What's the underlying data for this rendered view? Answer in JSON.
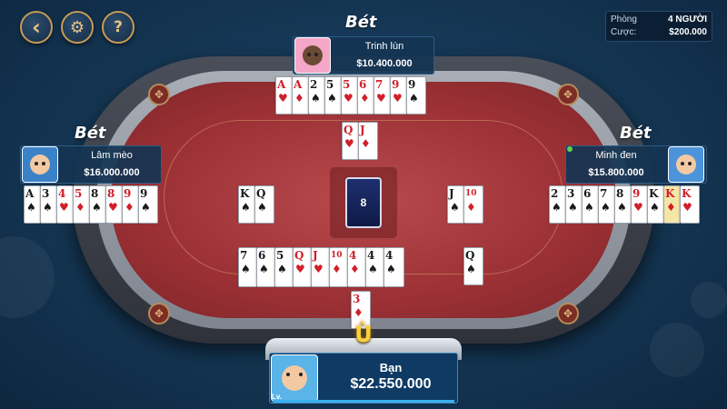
{
  "controls": {
    "back_icon": "‹",
    "settings_icon": "⚙",
    "help_icon": "?"
  },
  "room": {
    "room_label": "Phòng",
    "room_value": "4 NGƯỜI",
    "bet_label": "Cược:",
    "bet_value": "$200.000"
  },
  "center": {
    "deck_count": "8"
  },
  "players": {
    "top": {
      "status": "Bét",
      "name": "Trinh lùn",
      "money": "$10.400.000",
      "hand": [
        {
          "r": "A",
          "s": "♥",
          "c": "red"
        },
        {
          "r": "A",
          "s": "♦",
          "c": "red"
        },
        {
          "r": "2",
          "s": "♠",
          "c": "black"
        },
        {
          "r": "5",
          "s": "♠",
          "c": "black"
        },
        {
          "r": "5",
          "s": "♥",
          "c": "red"
        },
        {
          "r": "6",
          "s": "♦",
          "c": "red"
        },
        {
          "r": "7",
          "s": "♥",
          "c": "red"
        },
        {
          "r": "9",
          "s": "♥",
          "c": "red"
        },
        {
          "r": "9",
          "s": "♠",
          "c": "black"
        }
      ],
      "discards": [
        {
          "r": "Q",
          "s": "♥",
          "c": "red"
        },
        {
          "r": "J",
          "s": "♦",
          "c": "red"
        }
      ]
    },
    "left": {
      "status": "Bét",
      "name": "Lâm mèo",
      "money": "$16.000.000",
      "hand": [
        {
          "r": "A",
          "s": "♠",
          "c": "black"
        },
        {
          "r": "3",
          "s": "♠",
          "c": "black"
        },
        {
          "r": "4",
          "s": "♥",
          "c": "red"
        },
        {
          "r": "5",
          "s": "♦",
          "c": "red"
        },
        {
          "r": "8",
          "s": "♠",
          "c": "black"
        },
        {
          "r": "8",
          "s": "♥",
          "c": "red"
        },
        {
          "r": "9",
          "s": "♦",
          "c": "red"
        },
        {
          "r": "9",
          "s": "♠",
          "c": "black"
        }
      ],
      "discards": [
        {
          "r": "K",
          "s": "♠",
          "c": "black"
        },
        {
          "r": "Q",
          "s": "♠",
          "c": "black"
        }
      ]
    },
    "right": {
      "status": "Bét",
      "name": "Minh đen",
      "money": "$15.800.000",
      "hand": [
        {
          "r": "2",
          "s": "♠",
          "c": "black"
        },
        {
          "r": "3",
          "s": "♠",
          "c": "black"
        },
        {
          "r": "6",
          "s": "♠",
          "c": "black"
        },
        {
          "r": "7",
          "s": "♠",
          "c": "black"
        },
        {
          "r": "8",
          "s": "♠",
          "c": "black"
        },
        {
          "r": "9",
          "s": "♥",
          "c": "red"
        },
        {
          "r": "K",
          "s": "♠",
          "c": "black"
        },
        {
          "r": "K",
          "s": "♦",
          "c": "red",
          "hl": true
        },
        {
          "r": "K",
          "s": "♥",
          "c": "red"
        }
      ],
      "discards": [
        {
          "r": "J",
          "s": "♠",
          "c": "black"
        },
        {
          "r": "10",
          "s": "♦",
          "c": "red"
        }
      ]
    },
    "me": {
      "status_glyph": "Ù",
      "name": "Bạn",
      "money": "$22.550.000",
      "level_label": "Lv.",
      "hand": [
        {
          "r": "7",
          "s": "♠",
          "c": "black"
        },
        {
          "r": "6",
          "s": "♠",
          "c": "black"
        },
        {
          "r": "5",
          "s": "♠",
          "c": "black"
        },
        {
          "r": "Q",
          "s": "♥",
          "c": "red"
        },
        {
          "r": "J",
          "s": "♥",
          "c": "red"
        },
        {
          "r": "10",
          "s": "♦",
          "c": "red"
        },
        {
          "r": "4",
          "s": "♦",
          "c": "red"
        },
        {
          "r": "4",
          "s": "♠",
          "c": "black"
        },
        {
          "r": "4",
          "s": "♠",
          "c": "black"
        }
      ],
      "discards": [
        {
          "r": "Q",
          "s": "♠",
          "c": "black"
        }
      ],
      "drawn": [
        {
          "r": "3",
          "s": "♦",
          "c": "red"
        }
      ]
    }
  }
}
